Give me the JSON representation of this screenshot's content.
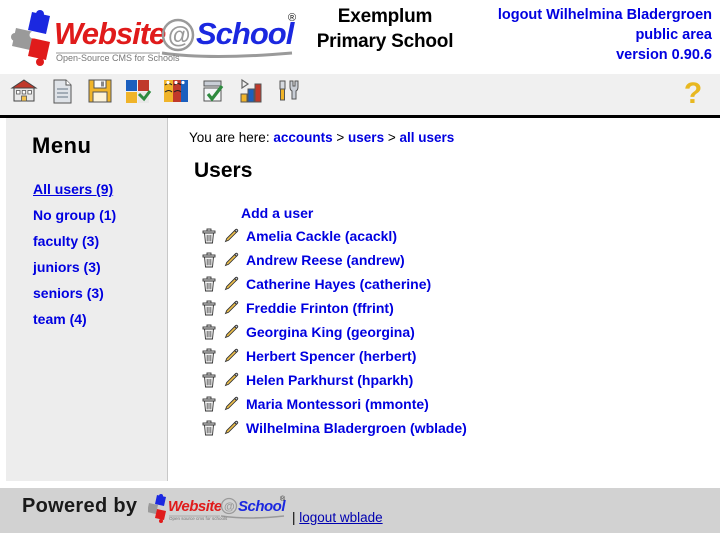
{
  "header": {
    "logo_alt": "Website@School",
    "logo_text_web": "Website",
    "logo_text_at": "@",
    "logo_text_school": "School",
    "logo_tagline": "Open-Source CMS for Schools",
    "logo_registered": "®",
    "school_name_line1": "Exemplum",
    "school_name_line2": "Primary School",
    "logout_line": "logout Wilhelmina Bladergroen",
    "area_line": "public area",
    "version_line": "version 0.90.6"
  },
  "toolbar": {
    "items": [
      {
        "name": "home-icon",
        "title": "Home"
      },
      {
        "name": "page-icon",
        "title": "Pages"
      },
      {
        "name": "save-icon",
        "title": "Save"
      },
      {
        "name": "modules-icon",
        "title": "Modules"
      },
      {
        "name": "accounts-icon",
        "title": "Accounts"
      },
      {
        "name": "tasks-icon",
        "title": "Tasks"
      },
      {
        "name": "statistics-icon",
        "title": "Statistics"
      },
      {
        "name": "tools-icon",
        "title": "Tools"
      }
    ],
    "help_label": "?",
    "help_name": "help-icon"
  },
  "sidebar": {
    "title": "Menu",
    "items": [
      {
        "label": "All users (9)",
        "active": true
      },
      {
        "label": "No group (1)",
        "active": false
      },
      {
        "label": "faculty (3)",
        "active": false
      },
      {
        "label": "juniors (3)",
        "active": false
      },
      {
        "label": "seniors (3)",
        "active": false
      },
      {
        "label": "team (4)",
        "active": false
      }
    ]
  },
  "breadcrumb": {
    "prefix": "You are here:",
    "sep": ">",
    "items": [
      {
        "label": "accounts"
      },
      {
        "label": "users"
      },
      {
        "label": "all users"
      }
    ]
  },
  "main": {
    "page_title": "Users",
    "add_user_label": "Add a user",
    "users": [
      {
        "label": "Amelia Cackle (acackl)"
      },
      {
        "label": "Andrew Reese (andrew)"
      },
      {
        "label": "Catherine Hayes (catherine)"
      },
      {
        "label": "Freddie Frinton (ffrint)"
      },
      {
        "label": "Georgina King (georgina)"
      },
      {
        "label": "Herbert Spencer (herbert)"
      },
      {
        "label": "Helen Parkhurst (hparkh)"
      },
      {
        "label": "Maria Montessori (mmonte)"
      },
      {
        "label": "Wilhelmina Bladergroen (wblade)"
      }
    ],
    "row_delete_icon": "trash-icon",
    "row_edit_icon": "pencil-icon"
  },
  "footer": {
    "powered_by": "Powered by",
    "logo_text_web": "Website",
    "logo_text_at": "@",
    "logo_text_school": "School",
    "logo_tagline": "Open source cms for schools",
    "logo_registered": "®",
    "separator": "|",
    "logout_label": "logout wblade"
  },
  "colors": {
    "link": "#0000e0",
    "header_bg": "#ffffff",
    "toolbar_bg": "#f0f0f0",
    "sidebar_bg": "#ededed",
    "footer_bg": "#d2d2d2",
    "logo_red": "#e01b1b",
    "logo_blue": "#1b28e0",
    "help_yellow": "#e8b820"
  }
}
